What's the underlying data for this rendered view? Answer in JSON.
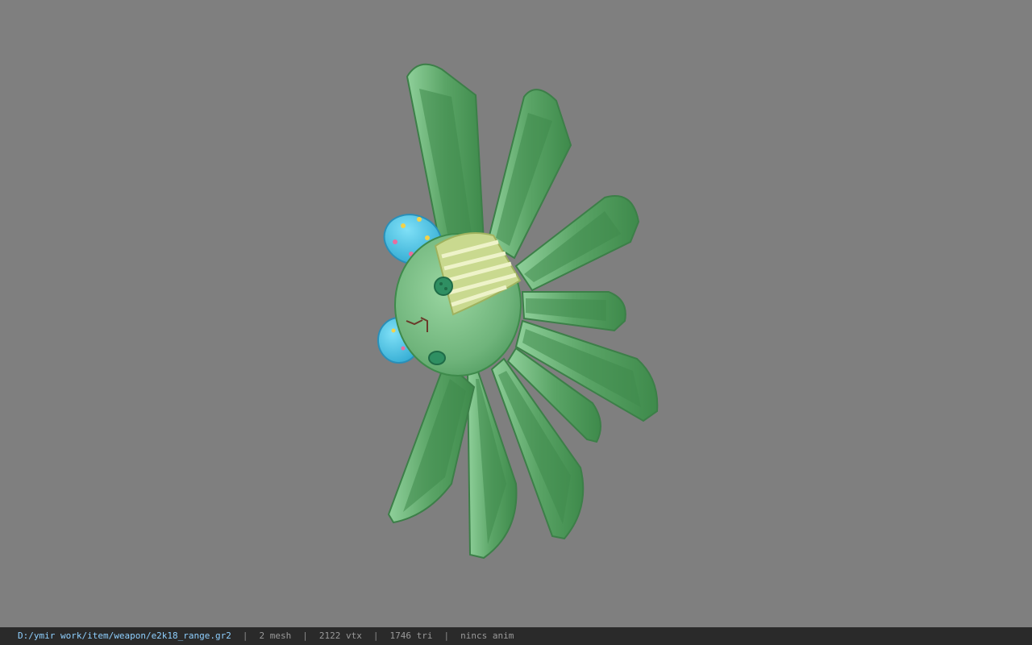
{
  "viewer": {
    "background_color": "#7f7f7f",
    "model_colors": {
      "body": "#79bf85",
      "body_shadow": "#4f9a5e",
      "tentacle": "#5aa466",
      "tentacle_inner": "#3f8a4c",
      "patch": "#c9d98f",
      "patch_stripe": "#e8efc6",
      "button": "#2f8f62",
      "ear": "#46c3e6",
      "mouth": "#6a3a2a"
    }
  },
  "status": {
    "file_path": "D:/ymir work/item/weapon/e2k18_range.gr2",
    "sep": "|",
    "mesh": "2 mesh",
    "vtx": "2122 vtx",
    "tri": "1746 tri",
    "anim": "nincs anim"
  }
}
